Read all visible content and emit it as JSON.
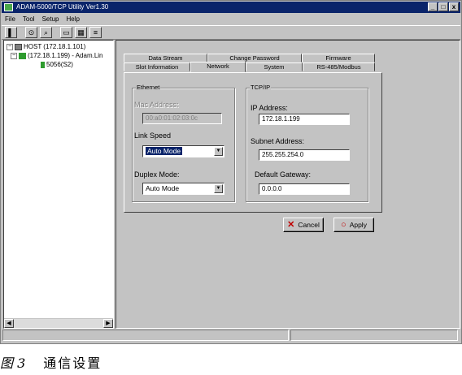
{
  "window": {
    "title": "ADAM-5000/TCP Utility Ver1.30",
    "buttons": [
      "_",
      "□",
      "x"
    ]
  },
  "menu": [
    "File",
    "Tool",
    "Setup",
    "Help"
  ],
  "toolbar": {
    "icons": [
      "exit-icon",
      "search-icon",
      "zoom-icon",
      "open-icon",
      "monitor-icon",
      "terminal-icon"
    ],
    "glyphs": [
      "▌",
      "⊙",
      "⌕",
      "▭",
      "▦",
      "≡"
    ]
  },
  "tree": {
    "root": "HOST (172.18.1.101)",
    "network": "(172.18.1.199) - Adam.Lin",
    "module": "5056(S2)",
    "expanders": [
      "−",
      "−"
    ]
  },
  "tabs": {
    "back_row": [
      "Data Stream",
      "Change Password",
      "Firmware"
    ],
    "front_row": [
      "Slot Information",
      "Network",
      "System",
      "RS-485/Modbus"
    ],
    "active": "Network"
  },
  "ethernet": {
    "title": "Ethernet",
    "mac_label": "Mac Address:",
    "mac_value": "00:a0:01:02:03:0c",
    "link_speed_label": "Link Speed",
    "link_speed_value": "Auto Mode",
    "duplex_label": "Duplex Mode:",
    "duplex_value": "Auto Mode"
  },
  "tcpip": {
    "title": "TCP/IP",
    "ip_label": "IP Address:",
    "ip_value": "172.18.1.199",
    "subnet_label": "Subnet Address:",
    "subnet_value": "255.255.254.0",
    "gateway_label": "Default Gateway:",
    "gateway_value": "0.0.0.0"
  },
  "buttons": {
    "cancel": "Cancel",
    "apply": "Apply"
  },
  "caption": {
    "figure": "图 3",
    "text": "通信设置"
  },
  "colors": {
    "title_bar": "#0a246a",
    "face": "#c3c3c3",
    "accent_red": "#c00000",
    "tree_green": "#2e9b2e"
  }
}
